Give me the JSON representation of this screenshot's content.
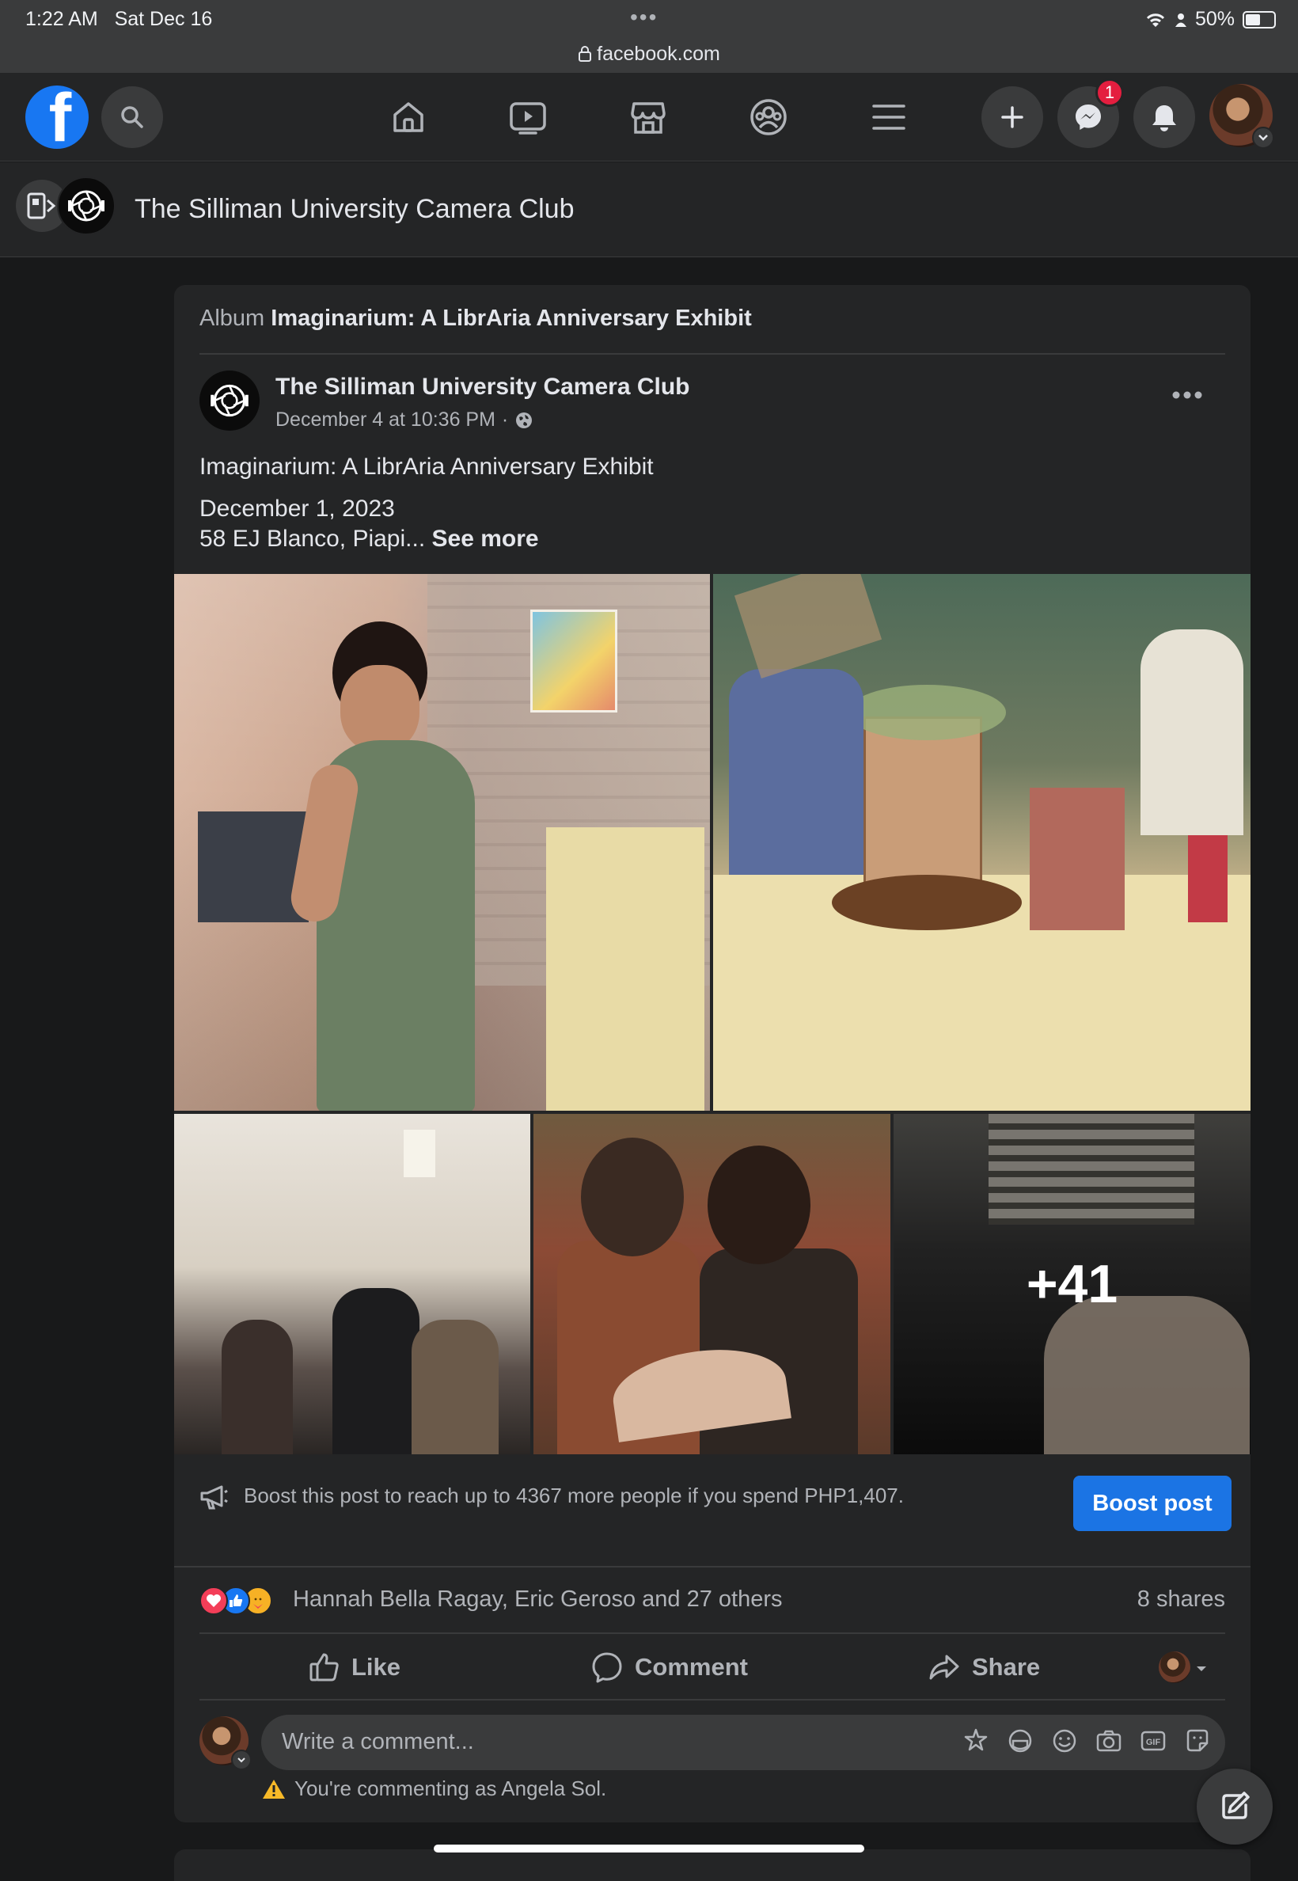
{
  "status_bar": {
    "time": "1:22 AM",
    "date": "Sat Dec 16",
    "battery": "50%",
    "url": "facebook.com"
  },
  "nav": {
    "messenger_badge": "1",
    "icons": [
      "facebook-logo-icon",
      "search-icon",
      "home-icon",
      "watch-icon",
      "marketplace-icon",
      "groups-icon",
      "menu-icon",
      "plus-icon",
      "messenger-icon",
      "bell-icon"
    ]
  },
  "page_header": {
    "title": "The Silliman University Camera Club"
  },
  "post": {
    "album_prefix": "Album",
    "album_title": "Imaginarium: A LibrAria Anniversary Exhibit",
    "author": "The Silliman University Camera Club",
    "timestamp": "December 4 at 10:36 PM",
    "separator": "·",
    "body_line1": "Imaginarium: A LibrAria Anniversary Exhibit",
    "body_line2": "December 1, 2023",
    "body_line3": "58 EJ Blanco, Piapi...",
    "see_more": "See more",
    "more_photos": "+41",
    "boost_text": "Boost this post to reach up to 4367 more people if you spend PHP1,407.",
    "boost_button": "Boost post",
    "reactions_text": "Hannah Bella Ragay, Eric Geroso and 27 others",
    "shares": "8 shares",
    "actions": {
      "like": "Like",
      "comment": "Comment",
      "share": "Share"
    },
    "comment_placeholder": "Write a comment...",
    "commenting_as": "You're commenting as Angela Sol."
  },
  "colors": {
    "background": "#18191a",
    "card": "#242526",
    "accent": "#1b74e4",
    "badge": "#e41e3f"
  }
}
